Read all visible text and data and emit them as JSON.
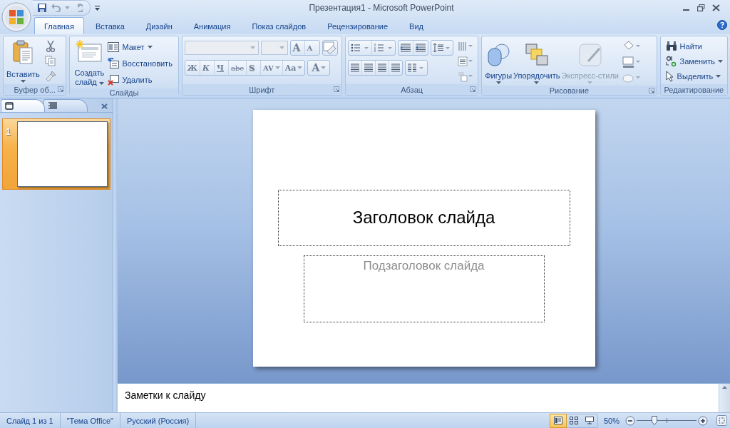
{
  "window": {
    "title": "Презентация1 - Microsoft PowerPoint"
  },
  "tabs": [
    {
      "label": "Главная",
      "selected": true
    },
    {
      "label": "Вставка",
      "selected": false
    },
    {
      "label": "Дизайн",
      "selected": false
    },
    {
      "label": "Анимация",
      "selected": false
    },
    {
      "label": "Показ слайдов",
      "selected": false
    },
    {
      "label": "Рецензирование",
      "selected": false
    },
    {
      "label": "Вид",
      "selected": false
    }
  ],
  "ribbon_groups": [
    {
      "kind": "clipboard",
      "label": "Буфер об...",
      "launcher": true,
      "paste": {
        "label": "Вставить",
        "dropdown": true
      }
    },
    {
      "kind": "slides",
      "label": "Слайды",
      "launcher": false,
      "new_slide": {
        "label": "Создать слайд",
        "dropdown": true
      },
      "small": [
        {
          "label": "Макет",
          "dropdown": true
        },
        {
          "label": "Восстановить",
          "dropdown": false
        },
        {
          "label": "Удалить",
          "dropdown": false
        }
      ]
    },
    {
      "kind": "font",
      "label": "Шрифт",
      "launcher": true,
      "grow": "A",
      "shrink": "A",
      "format_buttons": [
        {
          "label": "Ж",
          "dropdown": false
        },
        {
          "label": "К",
          "dropdown": false
        },
        {
          "label": "Ч",
          "dropdown": false
        },
        {
          "label": "abc",
          "dropdown": false
        },
        {
          "label": "S",
          "dropdown": false
        },
        {
          "label": "AV",
          "dropdown": true
        },
        {
          "label": "Aa",
          "dropdown": true
        }
      ],
      "color_button": {
        "label": "A",
        "dropdown": true
      }
    },
    {
      "kind": "paragraph",
      "label": "Абзац",
      "launcher": true
    },
    {
      "kind": "drawing",
      "label": "Рисование",
      "launcher": true,
      "large": [
        {
          "label": "Фигуры",
          "disabled": false
        },
        {
          "label": "Упорядочить",
          "disabled": false
        },
        {
          "label": "Экспресс-стили",
          "disabled": true
        }
      ]
    },
    {
      "kind": "editing",
      "label": "Редактирование",
      "launcher": false,
      "small": [
        {
          "label": "Найти",
          "dropdown": false
        },
        {
          "label": "Заменить",
          "dropdown": true
        },
        {
          "label": "Выделить",
          "dropdown": true
        }
      ]
    }
  ],
  "slide_pane": {
    "tabs": [
      {
        "kind": "slides",
        "selected": true
      },
      {
        "kind": "outline",
        "selected": false
      }
    ],
    "thumbnails": [
      {
        "number": "1",
        "selected": true
      }
    ]
  },
  "slide": {
    "title": "Заголовок слайда",
    "subtitle_placeholder": "Подзаголовок слайда"
  },
  "notes": {
    "placeholder": "Заметки к слайду"
  },
  "status_bar": {
    "items": [
      "Слайд 1 из 1",
      "\"Тема Office\"",
      "Русский (Россия)"
    ],
    "views": [
      {
        "kind": "normal",
        "selected": true
      },
      {
        "kind": "sorter",
        "selected": false
      },
      {
        "kind": "show",
        "selected": false
      }
    ],
    "zoom": "50%",
    "zoom_level": {
      "level": 0.27
    }
  }
}
